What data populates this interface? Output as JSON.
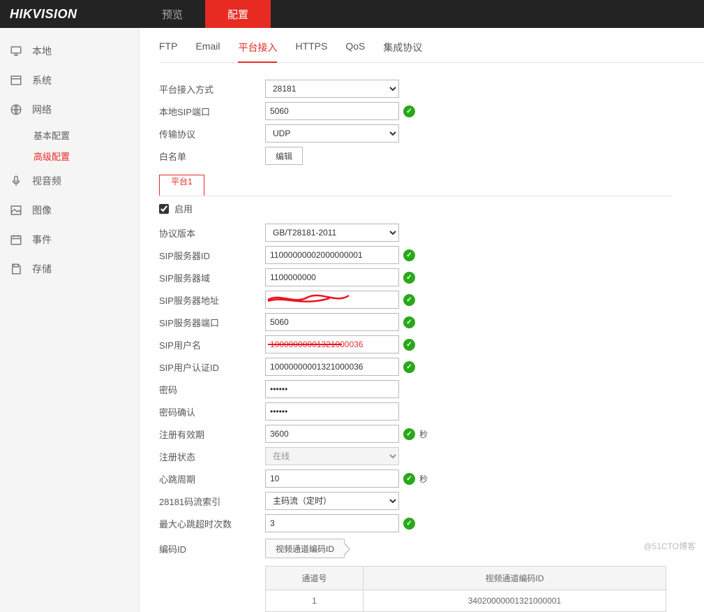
{
  "brand": "HIKVISION",
  "topnav": {
    "preview": "预览",
    "config": "配置"
  },
  "sidebar": {
    "local": "本地",
    "system": "系统",
    "network": "网络",
    "network_basic": "基本配置",
    "network_adv": "高级配置",
    "av": "视音频",
    "image": "图像",
    "event": "事件",
    "storage": "存储"
  },
  "tabs": {
    "ftp": "FTP",
    "email": "Email",
    "platform": "平台接入",
    "https": "HTTPS",
    "qos": "QoS",
    "integrated": "集成协议"
  },
  "form": {
    "access_mode_label": "平台接入方式",
    "access_mode_value": "28181",
    "local_sip_port_label": "本地SIP端口",
    "local_sip_port_value": "5060",
    "transport_label": "传输协议",
    "transport_value": "UDP",
    "whitelist_label": "白名单",
    "whitelist_btn": "编辑"
  },
  "platform_tab": "平台1",
  "enable_label": "启用",
  "details": {
    "proto_ver_label": "协议版本",
    "proto_ver_value": "GB/T28181-2011",
    "sip_server_id_label": "SIP服务器ID",
    "sip_server_id": "11000000002000000001",
    "sip_domain_label": "SIP服务器域",
    "sip_domain": "1100000000",
    "sip_addr_label": "SIP服务器地址",
    "sip_addr": "",
    "sip_port_label": "SIP服务器端口",
    "sip_port": "5060",
    "sip_user_label": "SIP用户名",
    "sip_user": "10000000001321000036",
    "sip_authid_label": "SIP用户认证ID",
    "sip_authid": "10000000001321000036",
    "pwd_label": "密码",
    "pwd_confirm_label": "密码确认",
    "reg_expiry_label": "注册有效期",
    "reg_expiry": "3600",
    "reg_state_label": "注册状态",
    "reg_state": "在线",
    "hb_label": "心跳周期",
    "hb": "10",
    "stream_idx_label": "28181码流索引",
    "stream_idx": "主码流（定时）",
    "max_hb_timeout_label": "最大心跳超时次数",
    "max_hb_timeout": "3",
    "codec_id_label": "编码ID",
    "seconds_unit": "秒"
  },
  "codec": {
    "chip": "视频通道编码ID",
    "col_channel": "通道号",
    "col_id": "视频通道编码ID",
    "rows": [
      {
        "channel": "1",
        "id": "34020000001321000001"
      }
    ]
  },
  "watermark": "@51CTO博客"
}
